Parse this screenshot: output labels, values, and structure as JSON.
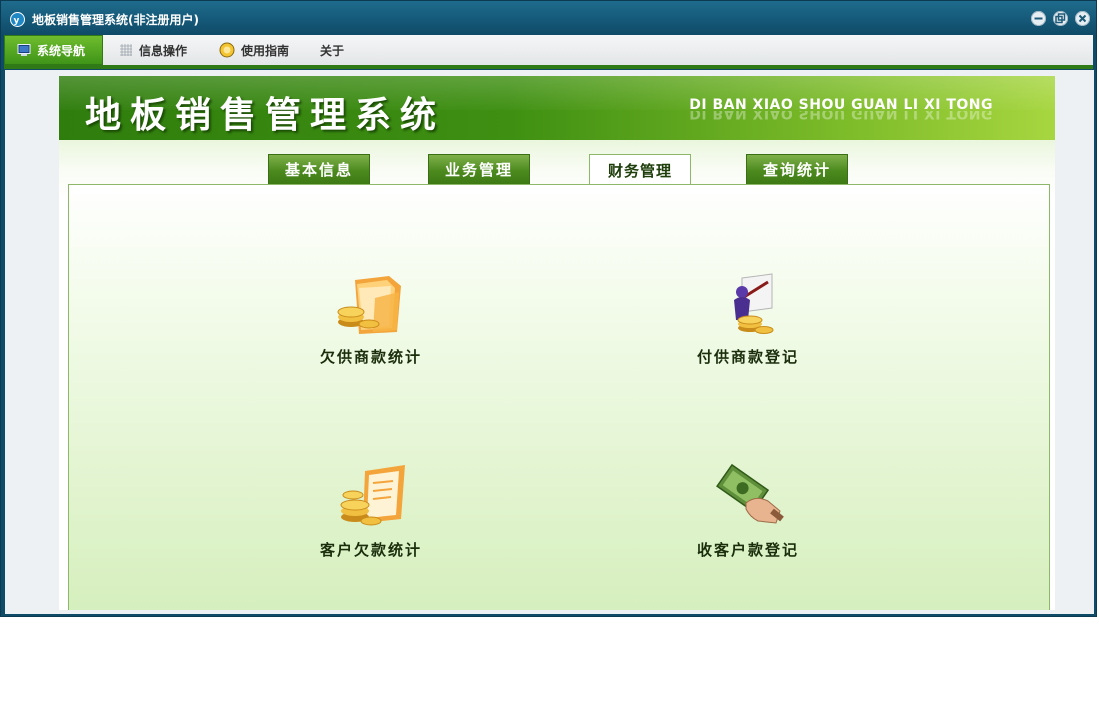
{
  "window": {
    "title": "地板销售管理系统(非注册用户)",
    "controls": [
      "minimize-icon",
      "restore-icon",
      "close-icon"
    ]
  },
  "menubar": {
    "items": [
      {
        "label": "系统导航",
        "icon": "monitor-icon",
        "active": true
      },
      {
        "label": "信息操作",
        "icon": "grid-icon",
        "active": false
      },
      {
        "label": "使用指南",
        "icon": "help-icon",
        "active": false
      },
      {
        "label": "关于",
        "icon": "",
        "active": false
      }
    ]
  },
  "banner": {
    "title": "地板销售管理系统",
    "subtitle": "DI BAN XIAO SHOU GUAN LI XI TONG"
  },
  "tabs": [
    {
      "label": "基本信息",
      "active": false
    },
    {
      "label": "业务管理",
      "active": false
    },
    {
      "label": "财务管理",
      "active": true
    },
    {
      "label": "查询统计",
      "active": false
    }
  ],
  "features": [
    {
      "label": "欠供商款统计",
      "icon": "folder-coins-icon"
    },
    {
      "label": "付供商款登记",
      "icon": "presentation-coins-icon"
    },
    {
      "label": "客户欠款统计",
      "icon": "coins-document-icon"
    },
    {
      "label": "收客户款登记",
      "icon": "hand-money-icon"
    }
  ],
  "colors": {
    "titlebar": "#155878",
    "accent_green": "#3f9418",
    "panel_green": "#d6efbe",
    "tab_green": "#4c8a1e"
  }
}
